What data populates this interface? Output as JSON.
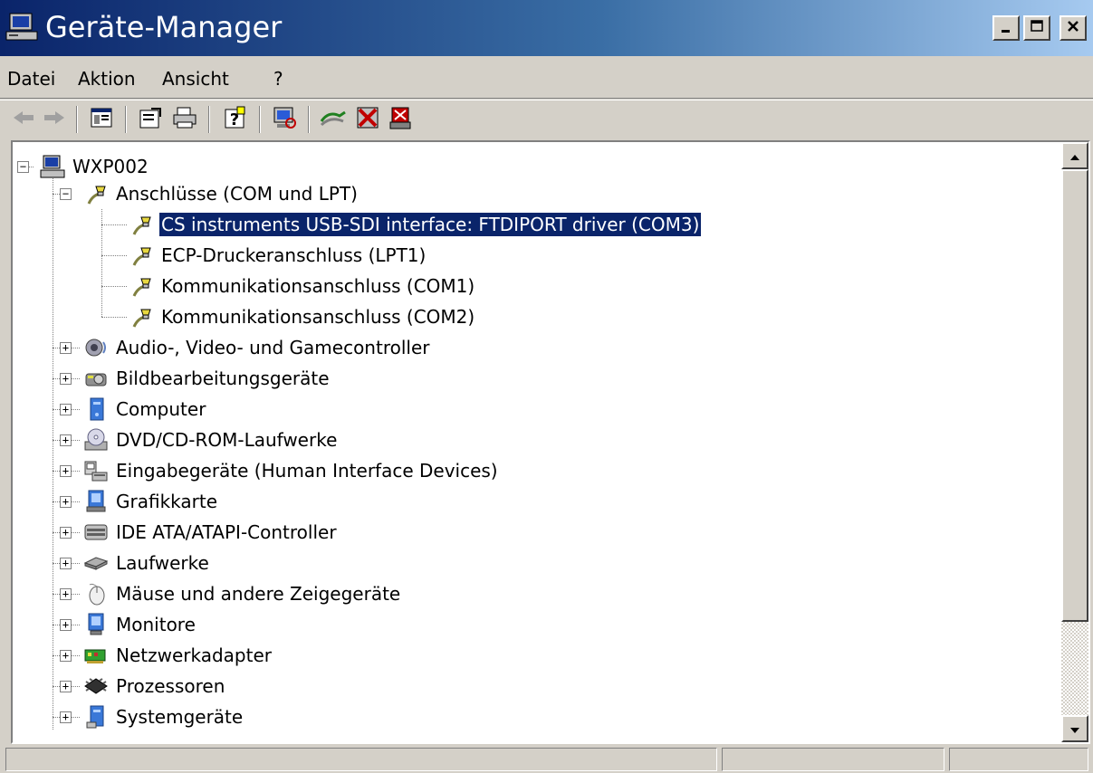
{
  "window": {
    "title": "Geräte-Manager",
    "buttons": {
      "minimize": "_",
      "maximize": "□",
      "close": "×"
    }
  },
  "menu": [
    "Datei",
    "Aktion",
    "Ansicht",
    "?"
  ],
  "toolbar": {
    "icons": [
      "back-arrow",
      "forward-arrow",
      "console-tree",
      "properties",
      "print",
      "help",
      "scan-hardware",
      "update-driver",
      "disable-device",
      "uninstall-device"
    ]
  },
  "tree": {
    "root": "WXP002",
    "expanded_category": "Anschlüsse (COM und LPT)",
    "children": [
      "CS instruments USB-SDI interface: FTDIPORT driver (COM3)",
      "ECP-Druckeranschluss (LPT1)",
      "Kommunikationsanschluss (COM1)",
      "Kommunikationsanschluss (COM2)"
    ],
    "selected": "CS instruments USB-SDI interface: FTDIPORT driver (COM3)",
    "categories": [
      "Audio-, Video- und Gamecontroller",
      "Bildbearbeitungsgeräte",
      "Computer",
      "DVD/CD-ROM-Laufwerke",
      "Eingabegeräte (Human Interface Devices)",
      "Grafikkarte",
      "IDE ATA/ATAPI-Controller",
      "Laufwerke",
      "Mäuse und andere Zeigegeräte",
      "Monitore",
      "Netzwerkadapter",
      "Prozessoren",
      "Systemgeräte"
    ]
  },
  "colors": {
    "title_start": "#0a246a",
    "title_end": "#a6caf0",
    "selection": "#0a246a",
    "face": "#d4d0c8"
  }
}
